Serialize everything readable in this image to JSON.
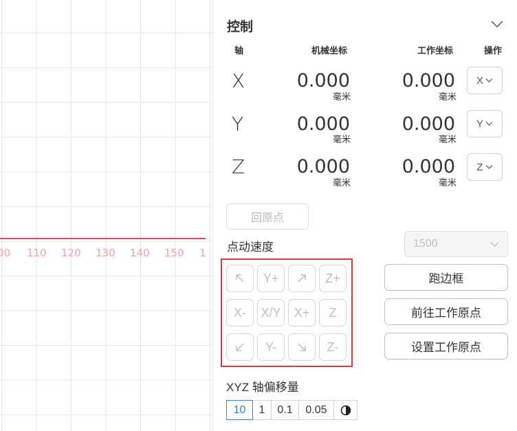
{
  "canvas": {
    "ticks": [
      "00",
      "110",
      "120",
      "130",
      "140",
      "150",
      "1"
    ]
  },
  "control": {
    "title": "控制",
    "headers": {
      "axis": "轴",
      "machine": "机械坐标",
      "work": "工作坐标",
      "action": "操作"
    },
    "rows": [
      {
        "axis": "X",
        "machine": "0.000",
        "work": "0.000",
        "unit": "毫米",
        "dropdown": "X"
      },
      {
        "axis": "Y",
        "machine": "0.000",
        "work": "0.000",
        "unit": "毫米",
        "dropdown": "Y"
      },
      {
        "axis": "Z",
        "machine": "0.000",
        "work": "0.000",
        "unit": "毫米",
        "dropdown": "Z"
      }
    ],
    "home_label": "回原点",
    "jog_speed_label": "点动速度",
    "jog_speed_value": "1500",
    "jog": {
      "up_left": "↖",
      "y_plus": "Y+",
      "up_right": "↗",
      "z_plus": "Z+",
      "x_minus": "X-",
      "xy": "X/Y",
      "x_plus": "X+",
      "z": "Z",
      "down_left": "↙",
      "y_minus": "Y-",
      "down_right": "↘",
      "z_minus": "Z-"
    },
    "frame_label": "跑边框",
    "goto_origin_label": "前往工作原点",
    "set_origin_label": "设置工作原点",
    "offset_label": "XYZ 轴偏移量",
    "steps": [
      "10",
      "1",
      "0.1",
      "0.05"
    ],
    "active_step": "10",
    "theme_icon": "half-circle-icon"
  }
}
